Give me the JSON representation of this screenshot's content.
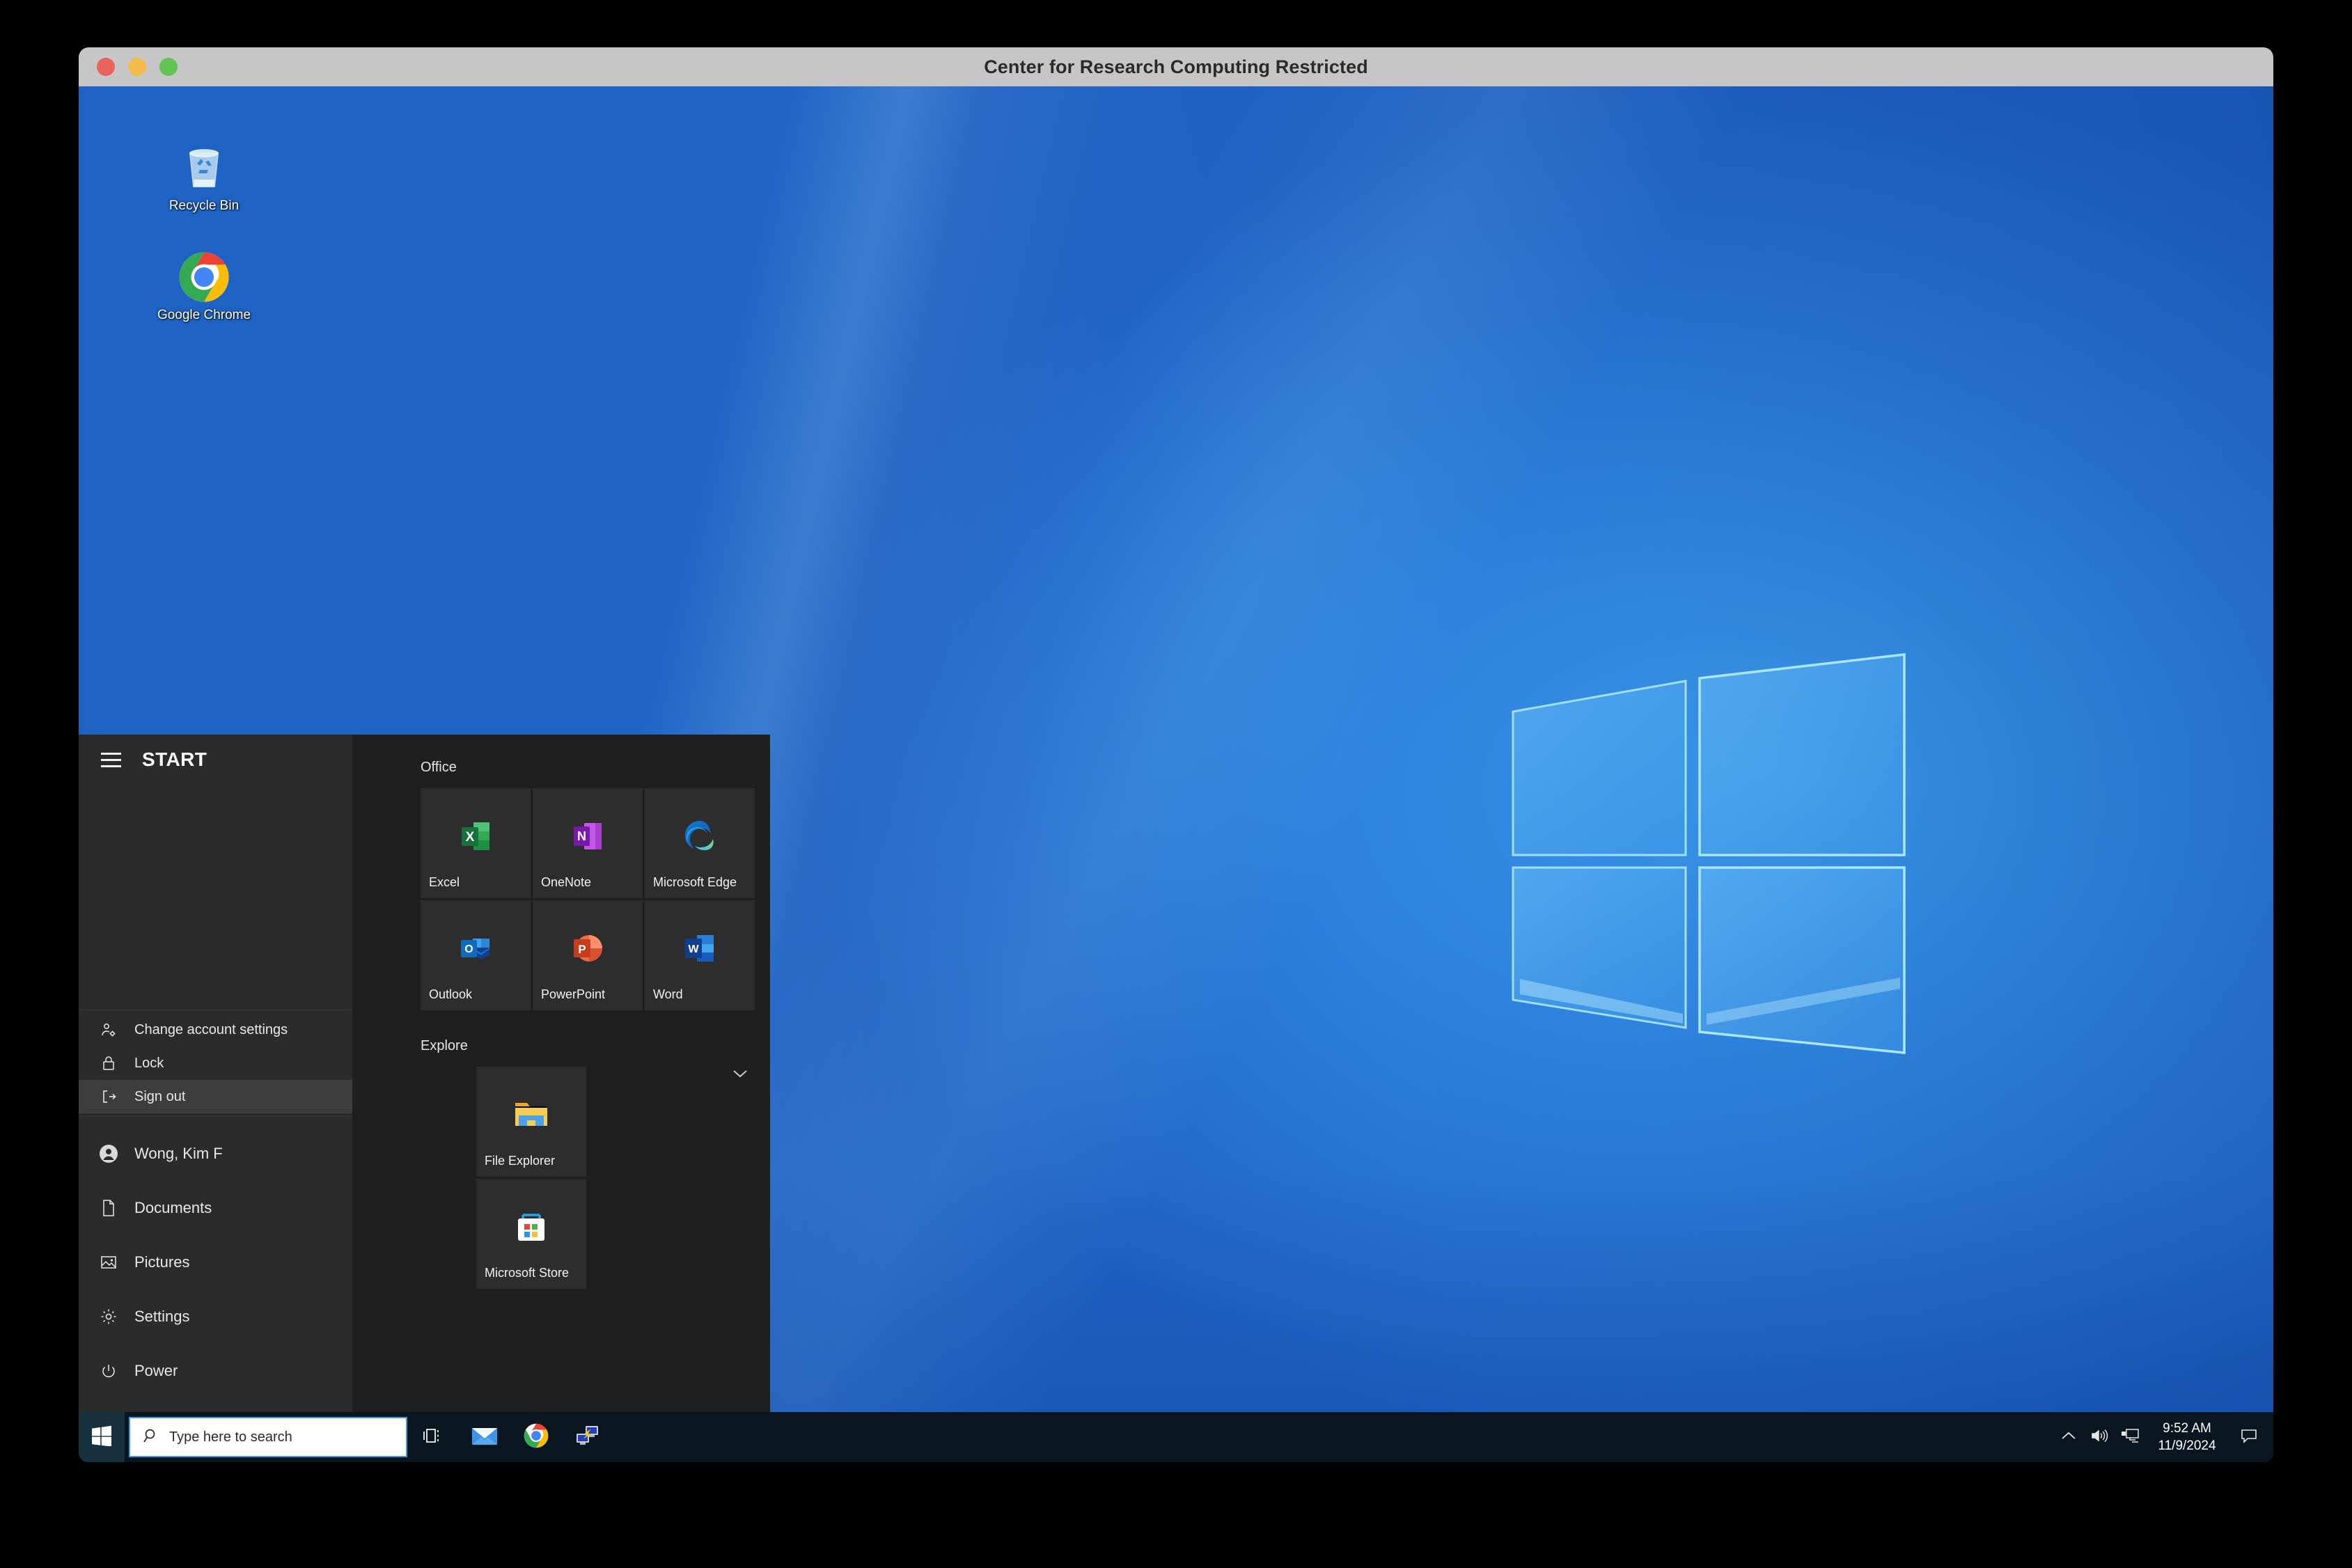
{
  "window": {
    "title": "Center for Research Computing Restricted",
    "controls": [
      {
        "name": "close",
        "color": "#e9635e"
      },
      {
        "name": "minimize",
        "color": "#f3bb4c"
      },
      {
        "name": "maximize",
        "color": "#61c454"
      }
    ]
  },
  "desktop": {
    "icons": [
      {
        "id": "recycle-bin",
        "label": "Recycle Bin",
        "icon": "recycle-bin-icon"
      },
      {
        "id": "google-chrome",
        "label": "Google Chrome",
        "icon": "chrome-icon"
      }
    ],
    "wallpaper": "windows-10-hero-blue",
    "accent": "#2f84e0"
  },
  "start_menu": {
    "header": {
      "hamburger_icon": "hamburger-icon",
      "label": "START"
    },
    "account_actions": [
      {
        "label": "Change account settings",
        "icon": "account-settings-icon",
        "selected": false
      },
      {
        "label": "Lock",
        "icon": "lock-icon",
        "selected": false
      },
      {
        "label": "Sign out",
        "icon": "sign-out-icon",
        "selected": true
      }
    ],
    "nav_items": [
      {
        "label": "Wong, Kim F",
        "icon": "user-avatar-icon"
      },
      {
        "label": "Documents",
        "icon": "document-icon"
      },
      {
        "label": "Pictures",
        "icon": "pictures-icon"
      },
      {
        "label": "Settings",
        "icon": "gear-icon"
      },
      {
        "label": "Power",
        "icon": "power-icon"
      }
    ],
    "groups": [
      {
        "title": "Office",
        "tiles": [
          {
            "label": "Excel",
            "icon": "excel-icon"
          },
          {
            "label": "OneNote",
            "icon": "onenote-icon"
          },
          {
            "label": "Microsoft Edge",
            "icon": "edge-icon"
          },
          {
            "label": "Outlook",
            "icon": "outlook-icon"
          },
          {
            "label": "PowerPoint",
            "icon": "powerpoint-icon"
          },
          {
            "label": "Word",
            "icon": "word-icon"
          }
        ]
      },
      {
        "title": "Explore",
        "collapse_icon": "chevron-down-icon",
        "tiles": [
          {
            "label": "File Explorer",
            "icon": "file-explorer-icon"
          },
          {
            "label": "Microsoft Store",
            "icon": "microsoft-store-icon"
          }
        ]
      }
    ],
    "colors": {
      "left_panel": "#2b2b2b",
      "tiles_panel": "#1f1f1f",
      "tile": "#2d2d2d",
      "selected_item": "#3d3d3d"
    }
  },
  "taskbar": {
    "start_button_icon": "windows-logo-icon",
    "search": {
      "placeholder": "Type here to search",
      "value": "",
      "icon": "search-icon"
    },
    "buttons": [
      {
        "name": "task-view",
        "icon": "task-view-icon"
      },
      {
        "name": "mail",
        "icon": "mail-icon"
      },
      {
        "name": "google-chrome",
        "icon": "chrome-icon"
      },
      {
        "name": "remote-desktop",
        "icon": "remote-desktop-icon"
      }
    ],
    "tray": [
      {
        "name": "show-hidden-icons",
        "icon": "chevron-up-icon"
      },
      {
        "name": "volume",
        "icon": "speaker-icon"
      },
      {
        "name": "network",
        "icon": "network-icon"
      }
    ],
    "clock": {
      "time": "9:52 AM",
      "date": "11/9/2024"
    },
    "notifications_icon": "notification-icon",
    "background": "#081620"
  }
}
